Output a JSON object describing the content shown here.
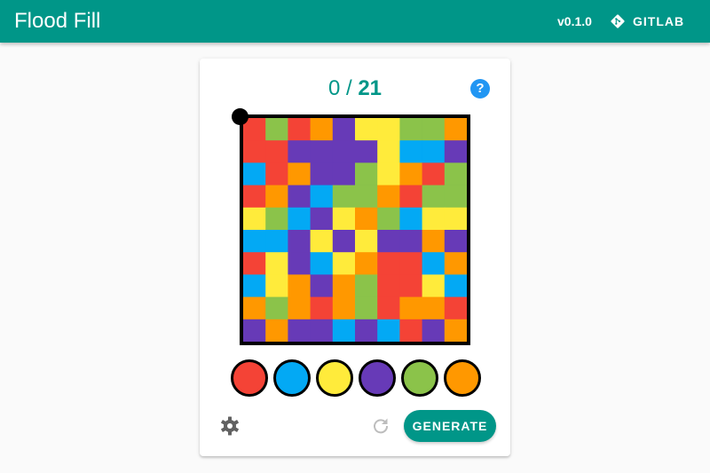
{
  "app": {
    "title": "Flood Fill",
    "version": "v0.1.0",
    "gitlab_label": "GITLAB",
    "accent_color": "#009688"
  },
  "game": {
    "moves_made": "0",
    "moves_separator": " / ",
    "max_moves": "21",
    "help_label": "?",
    "palette": {
      "R": "#f44336",
      "B": "#03a9f4",
      "Y": "#ffeb3b",
      "P": "#673ab7",
      "G": "#8bc34a",
      "O": "#ff9800"
    },
    "board": [
      "RGROPYYGGO",
      "RRPPPPYBBP",
      "BROPPGYORG",
      "ROPBGGORGG",
      "YGBPYOGBYY",
      "BBPYPYPPOP",
      "RYPBYORRBO",
      "BYOPOGRRYB",
      "OGOROGROOR",
      "POPPBPBRPO"
    ],
    "swatches": [
      "R",
      "B",
      "Y",
      "P",
      "G",
      "O"
    ]
  },
  "controls": {
    "generate_label": "GENERATE",
    "settings_icon": "gear-icon",
    "reset_icon": "refresh-icon"
  }
}
